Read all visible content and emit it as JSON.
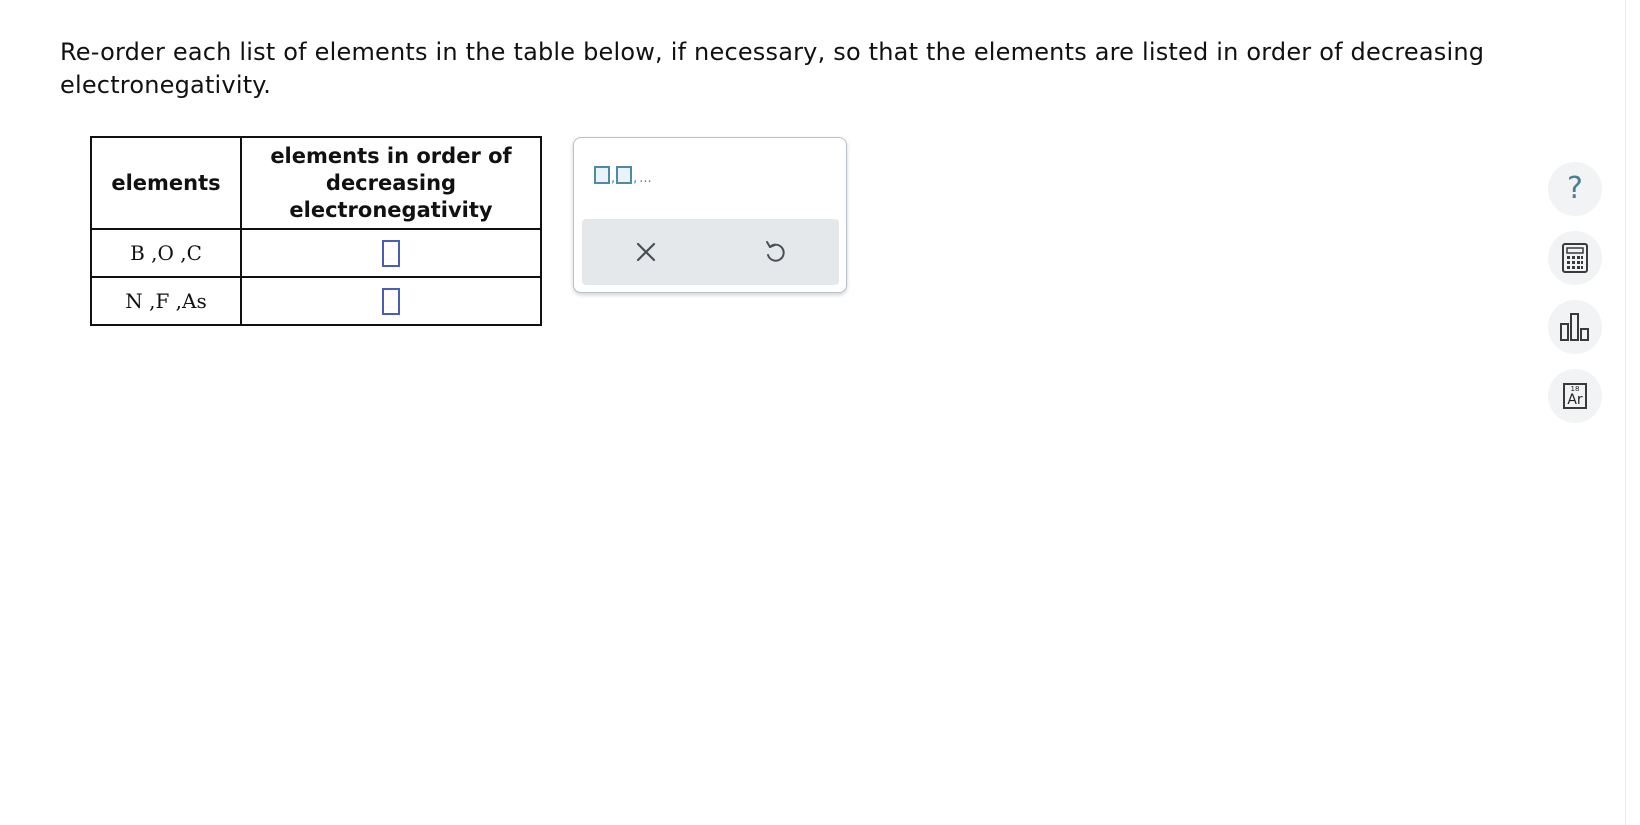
{
  "question": {
    "text": "Re-order each list of elements in the table below, if necessary, so that the elements are listed in order of decreasing electronegativity."
  },
  "table": {
    "headers": [
      "elements",
      "elements in order of decreasing electronegativity"
    ],
    "rows": [
      {
        "elements": "B ,O ,C",
        "answer": ""
      },
      {
        "elements": "N ,F ,As",
        "answer": ""
      }
    ]
  },
  "palette": {
    "template_separator": ",",
    "template_ellipsis": "...",
    "clear_icon": "x-icon",
    "undo_icon": "undo-icon"
  },
  "tools": {
    "help_label": "?",
    "help_icon": "help-icon",
    "calculator_icon": "calculator-icon",
    "data_icon": "bar-chart-icon",
    "periodic_table": {
      "number": "18",
      "symbol": "Ar"
    }
  },
  "colors": {
    "answer_box_border": "#4a5fb0",
    "accent": "#4b8ba8"
  }
}
